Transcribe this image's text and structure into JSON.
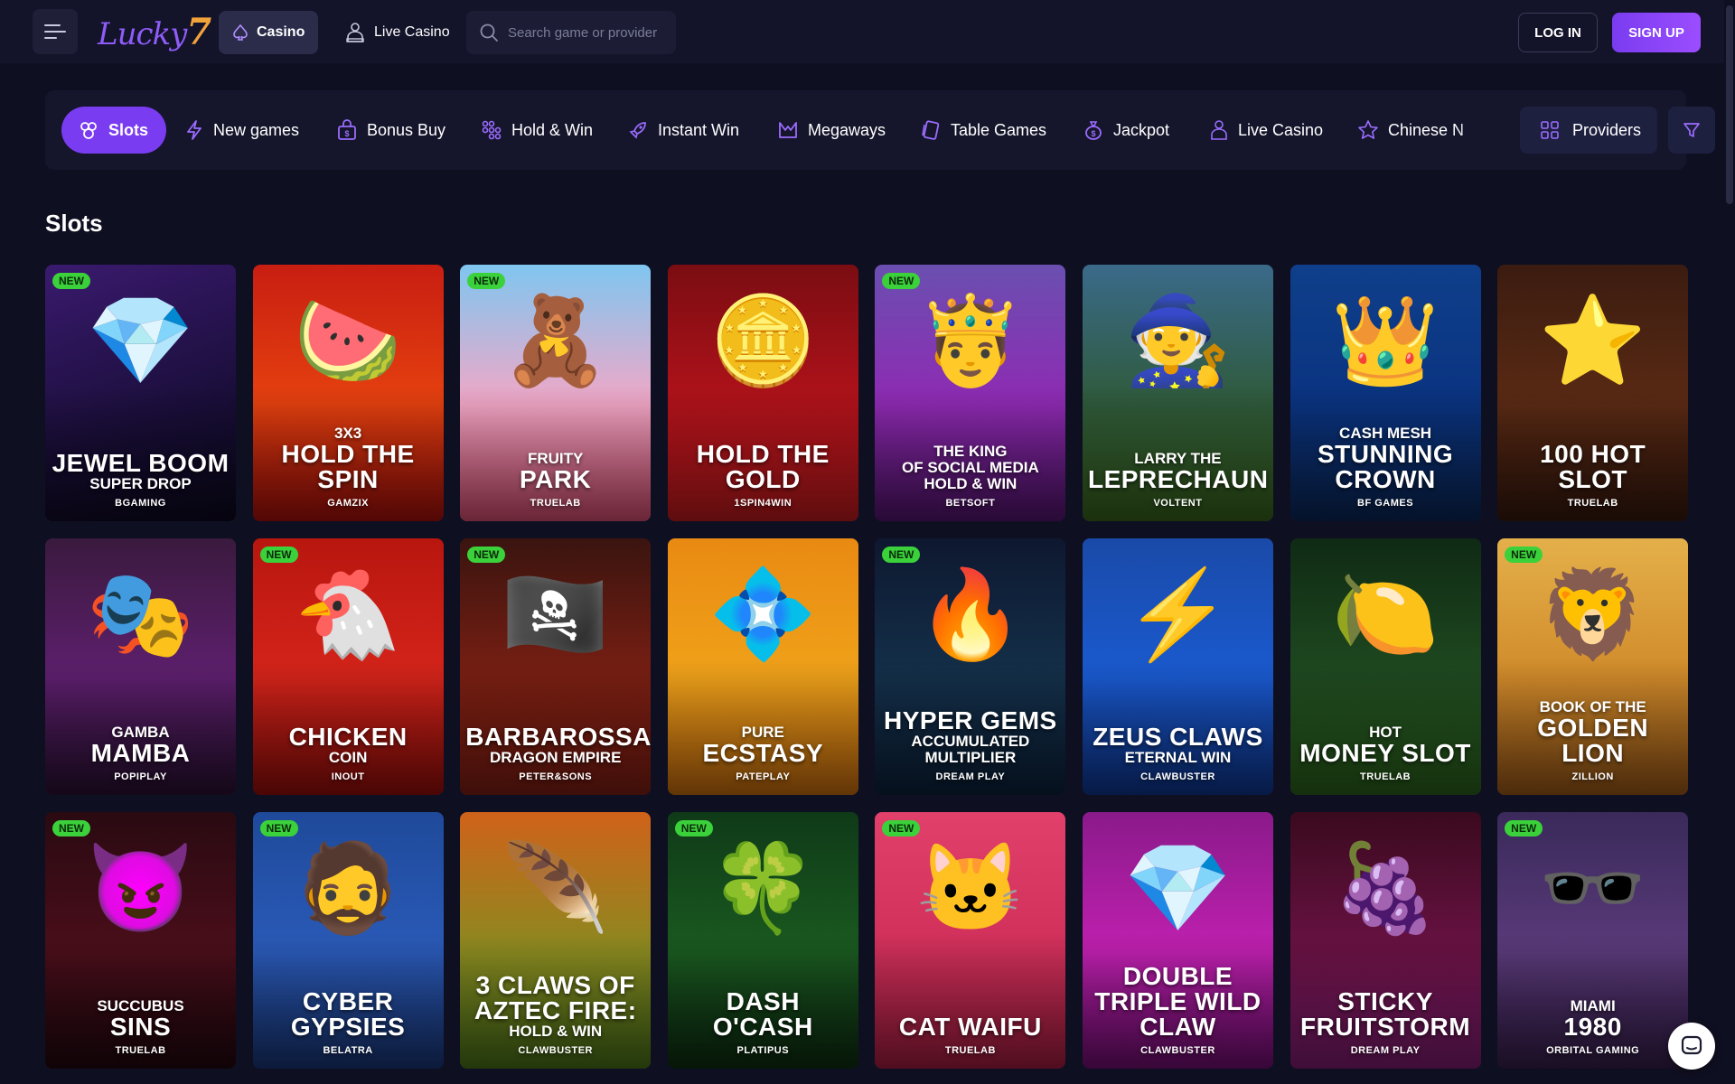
{
  "header": {
    "logo_text": "Lucky",
    "logo_seven": "7",
    "nav_casino": "Casino",
    "nav_live_casino": "Live Casino",
    "search_placeholder": "Search game or provider",
    "login_label": "LOG IN",
    "signup_label": "SIGN UP"
  },
  "categories": [
    {
      "label": "Slots",
      "icon": "slots-icon",
      "active": true
    },
    {
      "label": "New games",
      "icon": "lightning-icon"
    },
    {
      "label": "Bonus Buy",
      "icon": "bag-icon"
    },
    {
      "label": "Hold & Win",
      "icon": "dots-grid-icon"
    },
    {
      "label": "Instant Win",
      "icon": "rocket-icon"
    },
    {
      "label": "Megaways",
      "icon": "megaways-icon"
    },
    {
      "label": "Table Games",
      "icon": "cards-icon"
    },
    {
      "label": "Jackpot",
      "icon": "money-bag-icon"
    },
    {
      "label": "Live Casino",
      "icon": "dealer-icon"
    },
    {
      "label": "Chinese N",
      "icon": "star-icon"
    }
  ],
  "providers_label": "Providers",
  "section_title": "Slots",
  "colors": {
    "accent": "#7a3cf0",
    "new_badge": "#3bd13b",
    "background": "#0f0f22"
  },
  "games": [
    {
      "top": "",
      "title": "JEWEL BOOM",
      "bottom": "SUPER DROP",
      "provider": "BGAMING",
      "new": true,
      "art": "💎",
      "bg": "linear-gradient(160deg,#3a1a6e,#1a0e3a 60%,#0d0920)"
    },
    {
      "top": "3X3",
      "title": "HOLD THE SPIN",
      "bottom": "",
      "provider": "GAMZIX",
      "new": false,
      "art": "🍉",
      "bg": "linear-gradient(180deg,#c81e12,#e6410f 55%,#b5100c)"
    },
    {
      "top": "FRUITY",
      "title": "PARK",
      "bottom": "",
      "provider": "TRUELAB",
      "new": true,
      "art": "🧸",
      "bg": "linear-gradient(180deg,#7fc6f0,#f3a7c6 55%,#e9557a)"
    },
    {
      "top": "",
      "title": "HOLD THE GOLD",
      "bottom": "",
      "provider": "1SPIN4WIN",
      "new": false,
      "art": "🪙",
      "bg": "linear-gradient(180deg,#7a0d12,#b2121a 55%,#d11c20)"
    },
    {
      "top": "THE KING",
      "title": "",
      "bottom": "OF SOCIAL MEDIA HOLD & WIN",
      "provider": "BETSOFT",
      "new": true,
      "art": "🤴",
      "bg": "linear-gradient(180deg,#6a4fb0,#8f2ab3 55%,#5a1676)"
    },
    {
      "top": "LARRY THE",
      "title": "LEPRECHAUN",
      "bottom": "",
      "provider": "VOLTENT",
      "new": false,
      "art": "🧙",
      "bg": "linear-gradient(180deg,#3a6a8a,#2f5a3a 55%,#3c6b1e)"
    },
    {
      "top": "CASH MESH",
      "title": "STUNNING CROWN",
      "bottom": "",
      "provider": "BF GAMES",
      "new": false,
      "art": "👑",
      "bg": "linear-gradient(180deg,#0f3f8a,#0a3380 55%,#0b2a5e)"
    },
    {
      "top": "",
      "title": "100 HOT SLOT",
      "bottom": "",
      "provider": "TRUELAB",
      "new": false,
      "art": "⭐",
      "bg": "linear-gradient(180deg,#3b1c10,#5a2a14 55%,#3b1a0e)"
    },
    {
      "top": "GAMBA",
      "title": "MAMBA",
      "bottom": "",
      "provider": "POPIPLAY",
      "new": false,
      "art": "🎭",
      "bg": "linear-gradient(180deg,#3a1a3e,#5e1f6e 55%,#2e1238)"
    },
    {
      "top": "",
      "title": "CHICKEN",
      "bottom": "COIN",
      "provider": "INOUT",
      "new": true,
      "art": "🐔",
      "bg": "linear-gradient(180deg,#b8160f,#d5241a 55%,#a30f0b)"
    },
    {
      "top": "",
      "title": "BARBAROSSA",
      "bottom": "DRAGON EMPIRE",
      "provider": "PETER&SONS",
      "new": true,
      "art": "🏴‍☠️",
      "bg": "linear-gradient(180deg,#3a1410,#7a1f12 55%,#8a2014)"
    },
    {
      "top": "PURE",
      "title": "ECSTASY",
      "bottom": "",
      "provider": "PATEPLAY",
      "new": false,
      "art": "💠",
      "bg": "linear-gradient(180deg,#e98a12,#f0a21a 55%,#d9760e)"
    },
    {
      "top": "",
      "title": "HYPER GEMS",
      "bottom": "ACCUMULATED MULTIPLIER",
      "provider": "DREAM PLAY",
      "new": true,
      "art": "🔥",
      "bg": "linear-gradient(180deg,#0e1830,#14304a 55%,#0d2440)"
    },
    {
      "top": "",
      "title": "ZEUS CLAWS",
      "bottom": "ETERNAL WIN",
      "provider": "CLAWBUSTER",
      "new": false,
      "art": "⚡",
      "bg": "linear-gradient(180deg,#1a4aa8,#1a5ad0 55%,#0f3a9a)"
    },
    {
      "top": "HOT",
      "title": "MONEY SLOT",
      "bottom": "",
      "provider": "TRUELAB",
      "new": false,
      "art": "🍋",
      "bg": "linear-gradient(180deg,#0f2a14,#1f4a20 55%,#2e6a1e)"
    },
    {
      "top": "BOOK OF THE",
      "title": "GOLDEN LION",
      "bottom": "",
      "provider": "ZILLION",
      "new": true,
      "art": "🦁",
      "bg": "linear-gradient(180deg,#e4b04a,#d08a2a 55%,#a8601a)"
    },
    {
      "top": "SUCCUBUS",
      "title": "SINS",
      "bottom": "",
      "provider": "TRUELAB",
      "new": true,
      "art": "😈",
      "bg": "linear-gradient(180deg,#2a0a12,#4a0e1a 55%,#240810)"
    },
    {
      "top": "",
      "title": "CYBER GYPSIES",
      "bottom": "",
      "provider": "BELATRA",
      "new": true,
      "art": "🧔",
      "bg": "linear-gradient(180deg,#1f4a9a,#2a5ab8 55%,#1b3a80)"
    },
    {
      "top": "",
      "title": "3 CLAWS OF AZTEC FIRE:",
      "bottom": "HOLD & WIN",
      "provider": "CLAWBUSTER",
      "new": false,
      "art": "🪶",
      "bg": "linear-gradient(180deg,#d0621a,#8a8a20 55%,#4f7a1a)"
    },
    {
      "top": "",
      "title": "DASH O'CASH",
      "bottom": "",
      "provider": "PLATIPUS",
      "new": true,
      "art": "🍀",
      "bg": "linear-gradient(180deg,#0f3a18,#1a5a20 55%,#0e3012)"
    },
    {
      "top": "",
      "title": "CAT WAIFU",
      "bottom": "",
      "provider": "TRUELAB",
      "new": true,
      "art": "🐱",
      "bg": "linear-gradient(180deg,#e0406a,#d02f5a 55%,#b01f44)"
    },
    {
      "top": "",
      "title": "DOUBLE TRIPLE WILD CLAW",
      "bottom": "",
      "provider": "CLAWBUSTER",
      "new": false,
      "art": "💎",
      "bg": "linear-gradient(180deg,#8a1a8a,#c020b0 55%,#7a0f7a)"
    },
    {
      "top": "",
      "title": "STICKY FRUITSTORM",
      "bottom": "",
      "provider": "DREAM PLAY",
      "new": false,
      "art": "🍇",
      "bg": "linear-gradient(180deg,#3a0a1e,#6a1244 55%,#8a1f7a)"
    },
    {
      "top": "MIAMI",
      "title": "1980",
      "bottom": "",
      "provider": "ORBITAL GAMING",
      "new": true,
      "art": "🕶️",
      "bg": "linear-gradient(180deg,#3a2a5a,#5a3a7a 55%,#3a2050)"
    }
  ],
  "badge_new_label": "NEW"
}
